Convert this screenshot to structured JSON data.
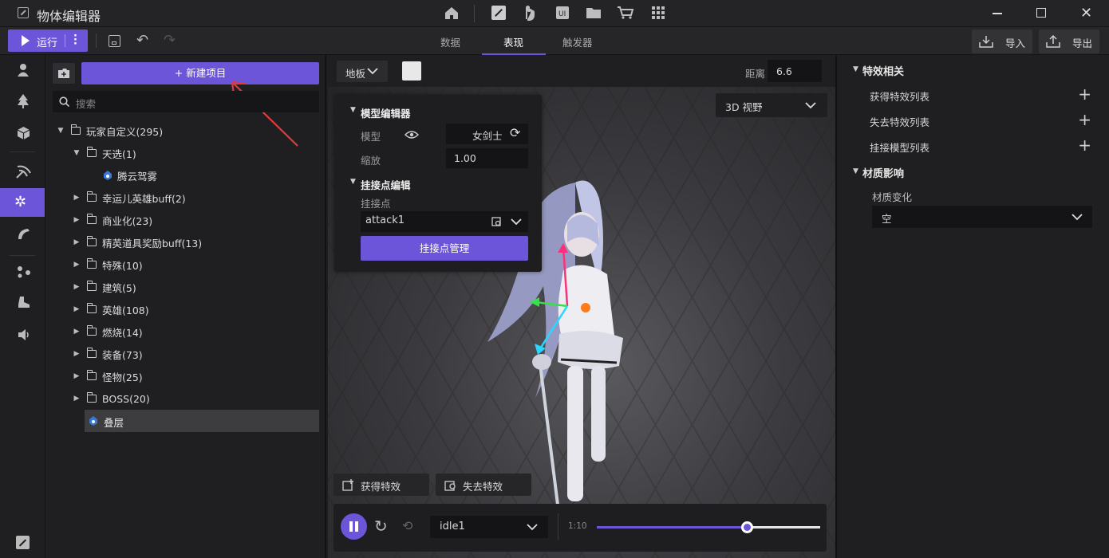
{
  "window": {
    "title": "物体编辑器"
  },
  "toolbar": {
    "run_label": "运行",
    "import_label": "导入",
    "export_label": "导出",
    "tabs": [
      {
        "label": "数据"
      },
      {
        "label": "表现"
      },
      {
        "label": "触发器"
      }
    ],
    "active_tab": "表现"
  },
  "tree": {
    "new_item_label": "+ 新建项目",
    "search_placeholder": "搜索",
    "items": [
      {
        "label": "玩家自定义(295)"
      },
      {
        "label": "天选(1)"
      },
      {
        "label": "腾云驾雾"
      },
      {
        "label": "幸运儿英雄buff(2)"
      },
      {
        "label": "商业化(23)"
      },
      {
        "label": "精英道具奖励buff(13)"
      },
      {
        "label": "特殊(10)"
      },
      {
        "label": "建筑(5)"
      },
      {
        "label": "英雄(108)"
      },
      {
        "label": "燃烧(14)"
      },
      {
        "label": "装备(73)"
      },
      {
        "label": "怪物(25)"
      },
      {
        "label": "BOSS(20)"
      },
      {
        "label": "叠层"
      }
    ]
  },
  "viewport": {
    "ground_label": "地板",
    "distance_label": "距离",
    "distance_value": "6.6",
    "view_mode": "3D 视野",
    "model_editor": {
      "title": "模型编辑器",
      "model_label": "模型",
      "model_value": "女剑士",
      "scale_label": "缩放",
      "scale_value": "1.00"
    },
    "attach_editor": {
      "title": "挂接点编辑",
      "point_label": "挂接点",
      "point_value": "attack1",
      "manage_label": "挂接点管理"
    },
    "gain_effect_label": "获得特效",
    "lose_effect_label": "失去特效",
    "anim": {
      "name": "idle1",
      "time": "1:10",
      "progress": 0.67
    }
  },
  "right": {
    "section1": "特效相关",
    "items": [
      {
        "label": "获得特效列表"
      },
      {
        "label": "失去特效列表"
      },
      {
        "label": "挂接模型列表"
      }
    ],
    "section2": "材质影响",
    "material_label": "材质变化",
    "material_value": "空"
  },
  "colors": {
    "accent": "#6c55d9",
    "bg": "#1f1f21"
  }
}
